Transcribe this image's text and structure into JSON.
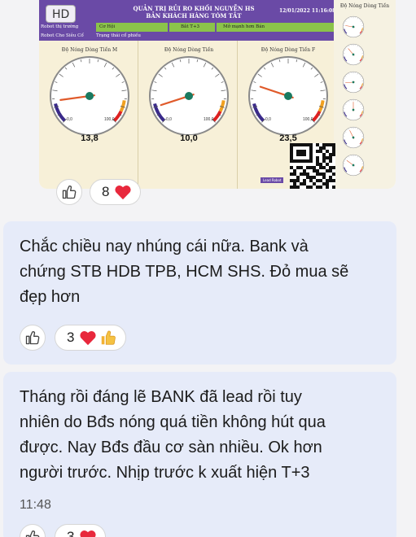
{
  "dashboard": {
    "hd_badge": "HD",
    "title_line1": "QUẢN TRỊ RỦI RO KHỐI NGUYỄN HS",
    "title_line2": "BẢN KHÁCH HÀNG TÓM TẮT",
    "date": "12/01/2022 11:16:08",
    "side_heading": "Độ Nóng Dòng Tiền",
    "row1": {
      "label": "Robot thị trường",
      "cell1": "Cơ Hội",
      "cell2": "Bắt T+3",
      "cell3": "Mở mạnh hơn Bán"
    },
    "row2": {
      "label": "Robot Cho Siêu Cổ",
      "cell1": "Trạng thái cổ phiếu"
    },
    "gauges": [
      {
        "title": "Độ Nóng Dòng Tiền M",
        "value": "13,8",
        "min": "0,0",
        "max": "100,0",
        "level": 13.8
      },
      {
        "title": "Độ Nóng Dòng Tiền",
        "value": "10,0",
        "min": "0,0",
        "max": "100,0",
        "level": 10.0
      },
      {
        "title": "Độ Nóng Dòng Tiền F",
        "value": "23,5",
        "min": "0,0",
        "max": "100,0",
        "level": 23.5
      }
    ],
    "qr_label": "Lead Robot",
    "colors": {
      "purple": "#6a4aa6",
      "green": "#8bc34a",
      "panel": "#f7f0d8",
      "needle": "#e05a2a",
      "hub": "#1a7a60"
    }
  },
  "reactions_image": {
    "count": "8"
  },
  "messages": [
    {
      "lines": [
        "Chắc chiều nay nhúng cái nữa. Bank và",
        "chứng STB HDB TPB, HCM SHS. Đỏ mua sẽ",
        "đẹp hơn"
      ],
      "reaction_count": "3"
    },
    {
      "lines": [
        "Tháng rồi đáng lẽ BANK đã lead rồi tuy",
        "nhiên do Bđs nóng quá tiền không hút qua",
        "được. Nay Bđs đầu cơ sàn nhiều. Ok hơn",
        "người trước. Nhịp trước k xuất hiện T+3"
      ],
      "time": "11:48",
      "reaction_count": "3"
    }
  ]
}
